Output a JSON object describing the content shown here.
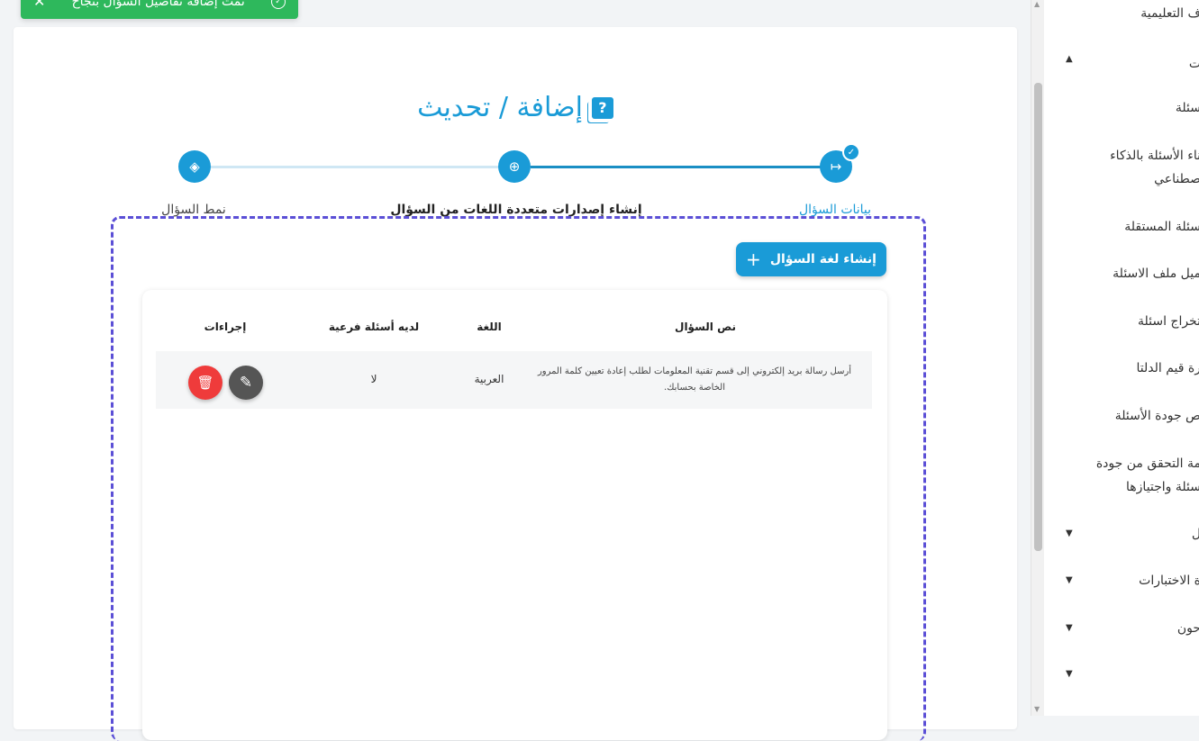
{
  "toast": {
    "message": "تمت إضافة تفاصيل السؤال بنجاح",
    "close_icon": "✕",
    "check_icon": "✓"
  },
  "page": {
    "title": "إضافة / تحديث"
  },
  "stepper": {
    "steps": [
      {
        "label": "بيانات السؤال",
        "state": "completed",
        "icon": "↦"
      },
      {
        "label": "إنشاء إصدارات متعددة اللغات من السؤال",
        "state": "active",
        "icon": "⊕"
      },
      {
        "label": "نمط السؤال",
        "state": "pending",
        "icon": "◈"
      }
    ],
    "completed_icon": "✓",
    "colors": {
      "primary": "#1a9bd7",
      "completed_label": "#1a9bd7"
    }
  },
  "create_button": {
    "label": "إنشاء لغة السؤال",
    "icon": "+"
  },
  "table": {
    "headers": {
      "question_text": "نص السؤال",
      "language": "اللغة",
      "has_sub": "لديه أسئلة فرعية",
      "actions": "إجراءات"
    },
    "rows": [
      {
        "question_text": "أرسل رسالة بريد إلكتروني إلى قسم تقنية المعلومات لطلب إعادة تعيين كلمة المرور الخاصة بحسابك.",
        "language": "العربية",
        "has_sub": "لا"
      }
    ],
    "edit_icon": "✎",
    "delete_icon": "🗑"
  },
  "sidebar": {
    "items": [
      {
        "label": "ف التعليمية",
        "caret": ""
      },
      {
        "label": "ت",
        "caret": "▲"
      },
      {
        "label": "سئلة",
        "caret": ""
      },
      {
        "label": "ناء الأسئلة بالذكاء",
        "caret": ""
      },
      {
        "label": "صطناعي",
        "caret": ""
      },
      {
        "label": "سئلة المستقلة",
        "caret": ""
      },
      {
        "label": "ميل ملف الاسئلة",
        "caret": ""
      },
      {
        "label": "تخراج اسئلة",
        "caret": ""
      },
      {
        "label": "رة قيم الدلتا",
        "caret": ""
      },
      {
        "label": "ص جودة الأسئلة",
        "caret": ""
      },
      {
        "label": "مة التحقق من جودة",
        "caret": ""
      },
      {
        "label": "سئلة واجتيازها",
        "caret": ""
      },
      {
        "label": "ل",
        "caret": "▼"
      },
      {
        "label": "ة الاختبارات",
        "caret": "▼"
      },
      {
        "label": "حون",
        "caret": "▼"
      },
      {
        "label": "",
        "caret": "▼"
      }
    ]
  }
}
